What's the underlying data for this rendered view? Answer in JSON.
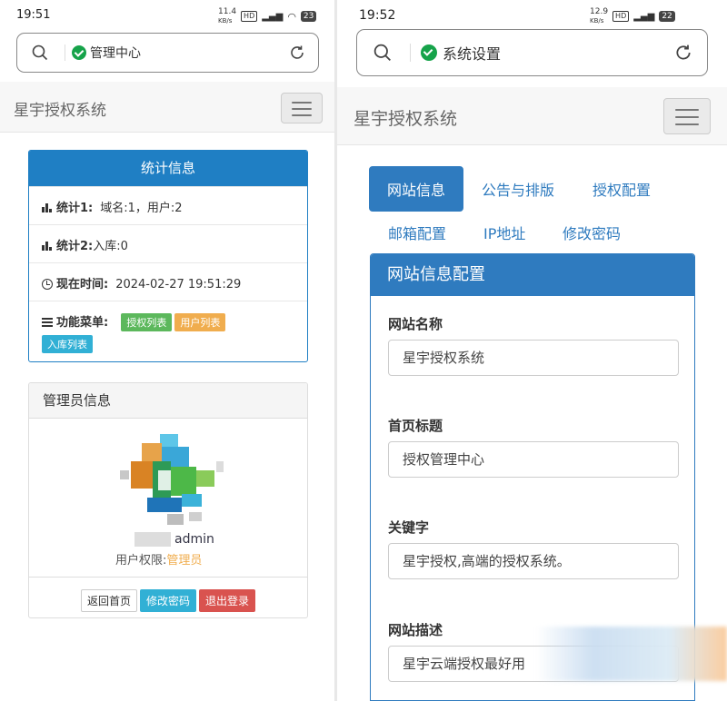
{
  "left": {
    "status": {
      "time": "19:51",
      "speed": "11.4",
      "speed_unit": "KB/s",
      "battery": "23"
    },
    "url_title": "管理中心",
    "brand": "星宇授权系统",
    "stats": {
      "title": "统计信息",
      "stat1_label": "统计1:",
      "stat1_value": "域名:1，用户:2",
      "stat2_label": "统计2:",
      "stat2_value": "入库:0",
      "time_label": "现在时间:",
      "time_value": "2024-02-27 19:51:29",
      "menu_label": "功能菜单:",
      "menu": [
        "授权列表",
        "用户列表",
        "入库列表"
      ]
    },
    "admin": {
      "title": "管理员信息",
      "username": "admin",
      "perm_label": "用户权限:",
      "role": "管理员",
      "buttons": [
        "返回首页",
        "修改密码",
        "退出登录"
      ]
    }
  },
  "right": {
    "status": {
      "time": "19:52",
      "speed": "12.9",
      "speed_unit": "KB/s",
      "battery": "22"
    },
    "url_title": "系统设置",
    "brand": "星宇授权系统",
    "tabs": [
      "网站信息",
      "公告与排版",
      "授权配置",
      "邮箱配置",
      "IP地址",
      "修改密码"
    ],
    "panel_title": "网站信息配置",
    "fields": [
      {
        "label": "网站名称",
        "value": "星宇授权系统"
      },
      {
        "label": "首页标题",
        "value": "授权管理中心"
      },
      {
        "label": "关键字",
        "value": "星宇授权,高端的授权系统。"
      },
      {
        "label": "网站描述",
        "value": "星宇云端授权最好用"
      }
    ]
  },
  "colors": {
    "primary": "#2f7bbf",
    "success": "#5cb85c",
    "warning": "#f0ad4e",
    "info": "#31b0d5",
    "danger": "#d9534f"
  }
}
